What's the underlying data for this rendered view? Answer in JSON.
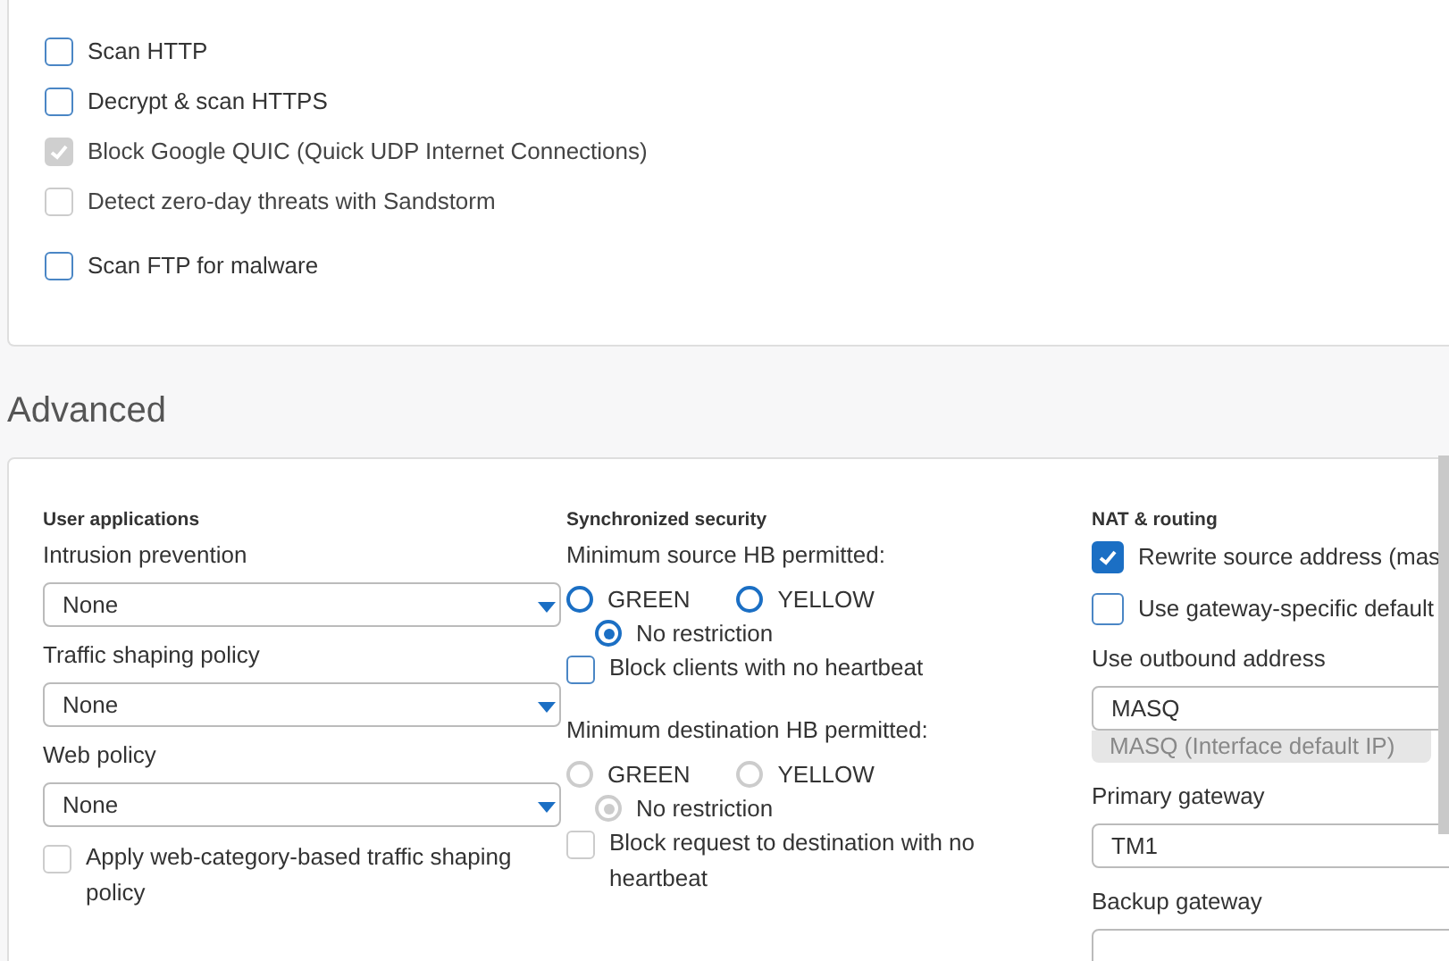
{
  "scanning": {
    "groups": [
      [
        {
          "label": "Scan HTTP",
          "checked": false,
          "disabled": false
        },
        {
          "label": "Decrypt & scan HTTPS",
          "checked": false,
          "disabled": false
        },
        {
          "label": "Block Google QUIC (Quick UDP Internet Connections)",
          "checked": true,
          "disabled": true
        },
        {
          "label": "Detect zero-day threats with Sandstorm",
          "checked": false,
          "disabled": true
        }
      ],
      [
        {
          "label": "Scan FTP for malware",
          "checked": false,
          "disabled": false
        }
      ]
    ]
  },
  "advanced": {
    "title": "Advanced",
    "user_applications": {
      "heading": "User applications",
      "selects": [
        {
          "label": "Intrusion prevention",
          "value": "None"
        },
        {
          "label": "Traffic shaping policy",
          "value": "None"
        },
        {
          "label": "Web policy",
          "value": "None"
        }
      ],
      "apply_shaping": {
        "label": "Apply web-category-based traffic shaping policy",
        "checked": false,
        "disabled": true
      }
    },
    "synchronized_security": {
      "heading": "Synchronized security",
      "groups": [
        {
          "label": "Minimum source HB permitted:",
          "disabled": false,
          "options": [
            {
              "label": "GREEN",
              "selected": false
            },
            {
              "label": "YELLOW",
              "selected": false
            },
            {
              "label": "No restriction",
              "selected": true
            }
          ],
          "checkbox": {
            "label": "Block clients with no heartbeat",
            "checked": false
          }
        },
        {
          "label": "Minimum destination HB permitted:",
          "disabled": true,
          "options": [
            {
              "label": "GREEN",
              "selected": false
            },
            {
              "label": "YELLOW",
              "selected": false
            },
            {
              "label": "No restriction",
              "selected": true
            }
          ],
          "checkbox": {
            "label": "Block request to destination with no heartbeat",
            "checked": false
          }
        }
      ]
    },
    "nat_routing": {
      "heading": "NAT & routing",
      "options": [
        {
          "label": "Rewrite source address (mas",
          "checked": true
        },
        {
          "label": "Use gateway-specific default",
          "checked": false
        }
      ],
      "outbound": {
        "label": "Use outbound address",
        "value": "MASQ",
        "hint": "MASQ (Interface default IP)"
      },
      "gateways": [
        {
          "label": "Primary gateway",
          "value": "TM1"
        },
        {
          "label": "Backup gateway"
        }
      ]
    }
  }
}
